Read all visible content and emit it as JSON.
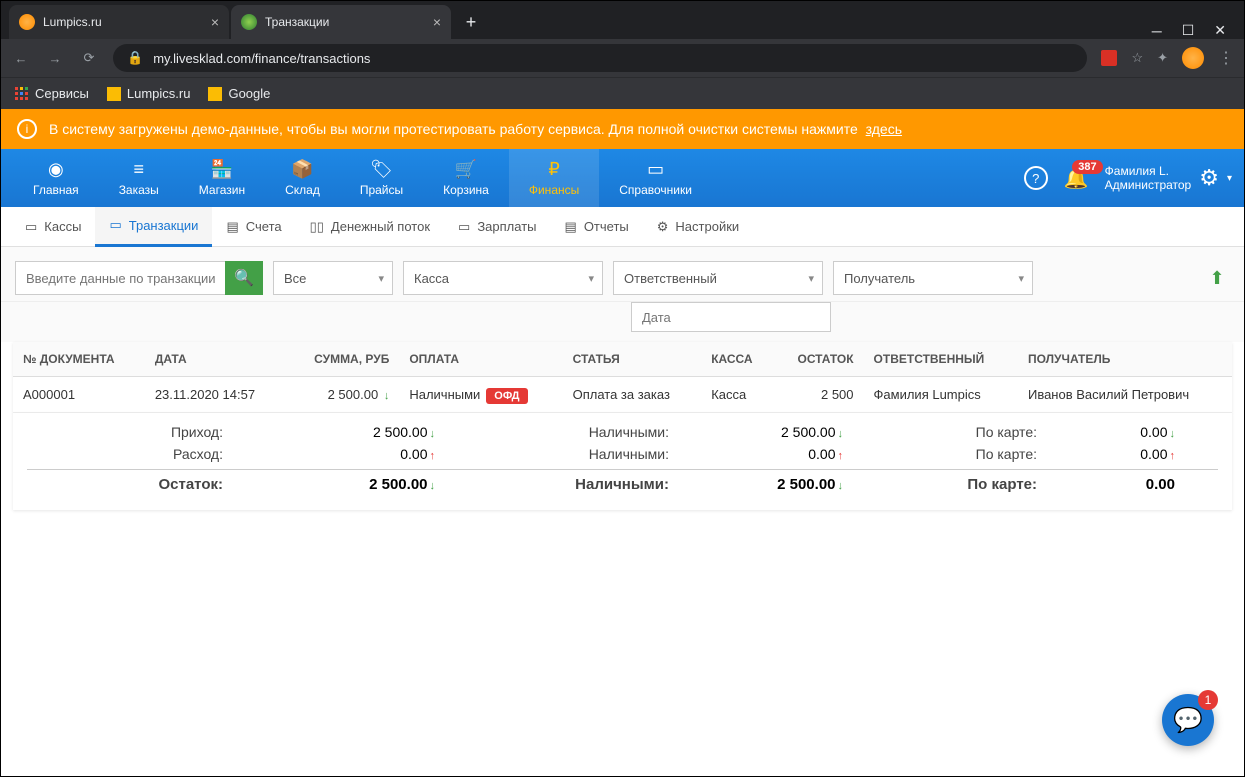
{
  "browser": {
    "tabs": [
      {
        "title": "Lumpics.ru"
      },
      {
        "title": "Транзакции"
      }
    ],
    "url": "my.livesklad.com/finance/transactions",
    "bookmarks": {
      "services": "Сервисы",
      "lumpics": "Lumpics.ru",
      "google": "Google"
    }
  },
  "banner": {
    "text": "В систему загружены демо-данные, чтобы вы могли протестировать работу сервиса. Для полной очистки системы нажмите",
    "link": "здесь"
  },
  "nav": {
    "items": [
      "Главная",
      "Заказы",
      "Магазин",
      "Склад",
      "Прайсы",
      "Корзина",
      "Финансы",
      "Справочники"
    ],
    "notif_count": "387",
    "user_name": "Фамилия L.",
    "user_role": "Администратор"
  },
  "subnav": {
    "items": [
      "Кассы",
      "Транзакции",
      "Счета",
      "Денежный поток",
      "Зарплаты",
      "Отчеты",
      "Настройки"
    ]
  },
  "filters": {
    "search_placeholder": "Введите данные по транзакции",
    "f1": "Все",
    "f2": "Касса",
    "f3": "Ответственный",
    "f4": "Получатель",
    "date_placeholder": "Дата"
  },
  "table": {
    "headers": {
      "doc": "№ ДОКУМЕНТА",
      "date": "ДАТА",
      "sum": "СУММА, РУБ",
      "pay": "ОПЛАТА",
      "article": "СТАТЬЯ",
      "kassa": "КАССА",
      "rest": "ОСТАТОК",
      "resp": "ОТВЕТСТВЕННЫЙ",
      "recv": "ПОЛУЧАТЕЛЬ"
    },
    "rows": [
      {
        "doc": "A000001",
        "date": "23.11.2020 14:57",
        "sum": "2 500.00",
        "pay": "Наличными",
        "ofd": "ОФД",
        "article": "Оплата за заказ",
        "kassa": "Касса",
        "rest": "2 500",
        "resp": "Фамилия Lumpics",
        "recv": "Иванов Василий Петрович"
      }
    ]
  },
  "summary": {
    "income_label": "Приход:",
    "income_val": "2 500.00",
    "expense_label": "Расход:",
    "expense_val": "0.00",
    "balance_label": "Остаток:",
    "balance_val": "2 500.00",
    "cash_label": "Наличными:",
    "cash_income": "2 500.00",
    "cash_expense": "0.00",
    "cash_balance": "2 500.00",
    "card_label": "По карте:",
    "card_income": "0.00",
    "card_expense": "0.00",
    "card_balance": "0.00"
  },
  "chat_badge": "1"
}
